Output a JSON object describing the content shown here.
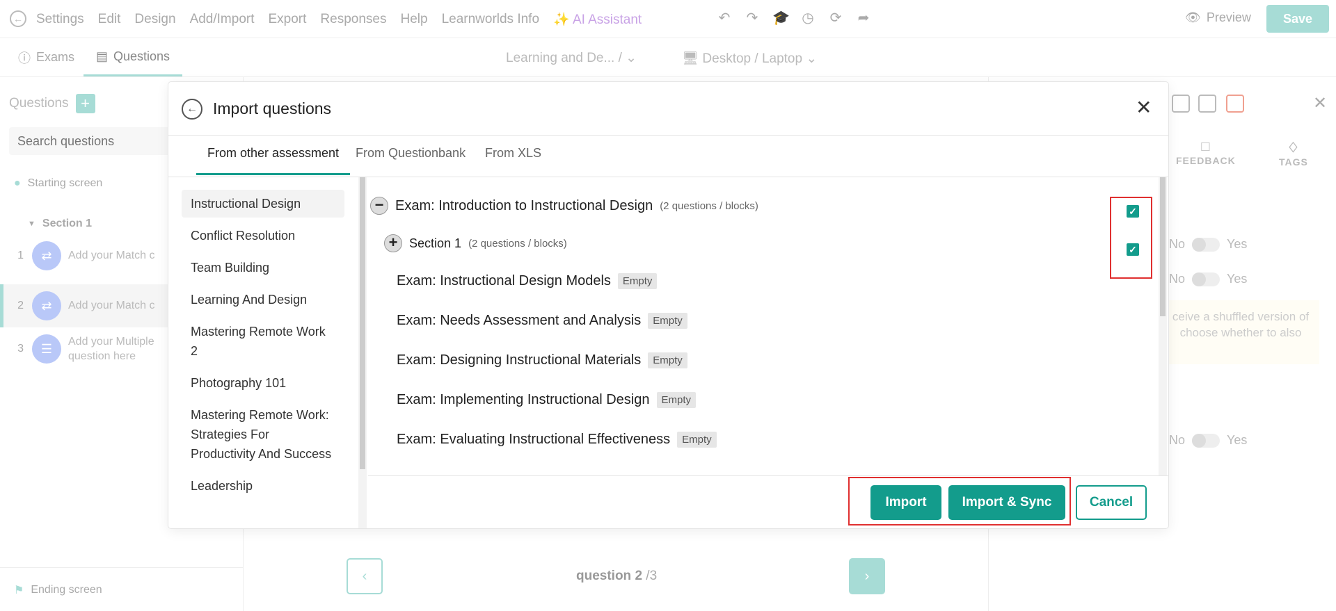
{
  "topbar": {
    "menu": [
      "Settings",
      "Edit",
      "Design",
      "Add/Import",
      "Export",
      "Responses",
      "Help",
      "Learnworlds Info"
    ],
    "ai_assistant": "AI Assistant",
    "preview": "Preview",
    "save": "Save"
  },
  "subbar": {
    "tab_exams": "Exams",
    "tab_questions": "Questions",
    "breadcrumb": "Learning and De... /",
    "device": "Desktop / Laptop"
  },
  "sidebar": {
    "title": "Questions",
    "search_placeholder": "Search questions",
    "starting_screen": "Starting screen",
    "section": "Section 1",
    "questions": [
      {
        "num": "1",
        "text": "Add your Match c"
      },
      {
        "num": "2",
        "text": "Add your Match c"
      },
      {
        "num": "3",
        "text": "Add your Multiple question here"
      }
    ],
    "ending_screen": "Ending screen"
  },
  "right_panel": {
    "tab_feedback": "FEEDBACK",
    "tab_tags": "TAGS",
    "no": "No",
    "yes": "Yes",
    "note": "ceive a shuffled version of choose whether to also"
  },
  "center": {
    "question_current": "question 2",
    "question_total": "/3"
  },
  "modal": {
    "title": "Import questions",
    "tabs": [
      "From other assessment",
      "From Questionbank",
      "From XLS"
    ],
    "assessments": [
      "Instructional Design",
      "Conflict Resolution",
      "Team Building",
      "Learning And Design",
      "Mastering Remote Work 2",
      "Photography 101",
      "Mastering Remote Work: Strategies For Productivity And Success",
      "Leadership"
    ],
    "tree_exam_title": "Exam: Introduction to Instructional Design",
    "tree_exam_count": "(2 questions / blocks)",
    "tree_section_title": "Section 1",
    "tree_section_count": "(2 questions / blocks)",
    "exams": [
      "Exam: Instructional Design Models",
      "Exam: Needs Assessment and Analysis",
      "Exam: Designing Instructional Materials",
      "Exam: Implementing Instructional Design",
      "Exam: Evaluating Instructional Effectiveness"
    ],
    "empty_label": "Empty",
    "btn_import": "Import",
    "btn_import_sync": "Import & Sync",
    "btn_cancel": "Cancel"
  }
}
